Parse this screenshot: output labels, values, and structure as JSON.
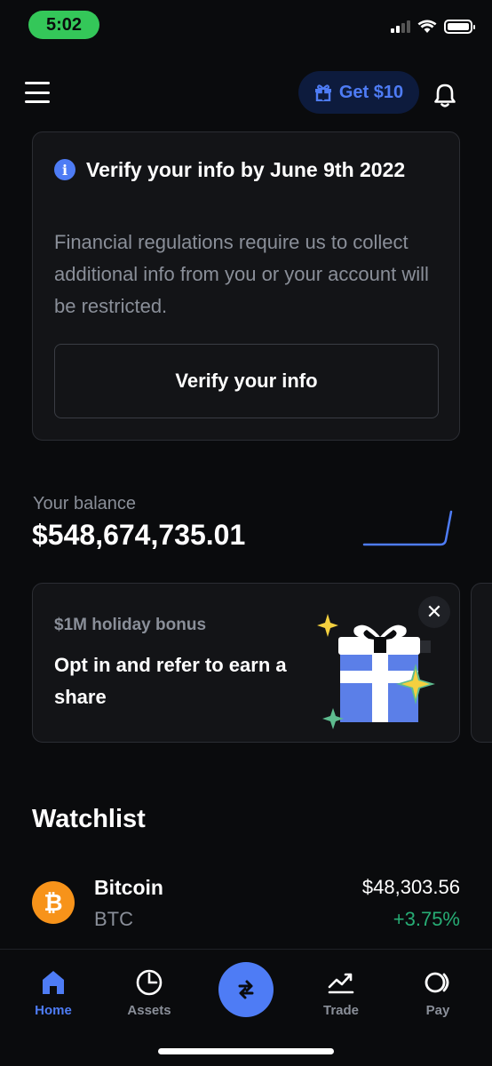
{
  "status_bar": {
    "time": "5:02"
  },
  "header": {
    "reward_label": "Get $10",
    "icons": [
      "menu-icon",
      "gift-icon",
      "bell-icon"
    ]
  },
  "verify_card": {
    "title": "Verify your info by June 9th 2022",
    "body": "Financial regulations require us to collect additional info from you or your account will be restricted.",
    "button_label": "Verify your info",
    "icon": "info-icon"
  },
  "balance": {
    "label": "Your balance",
    "value": "$548,674,735.01"
  },
  "promo": {
    "eyebrow": "$1M holiday bonus",
    "title": "Opt in and refer to earn a share",
    "close_symbol": "✕",
    "art": "gift-illustration"
  },
  "watchlist": {
    "title": "Watchlist",
    "items": [
      {
        "name": "Bitcoin",
        "symbol": "BTC",
        "price": "$48,303.56",
        "change": "+3.75%",
        "icon_glyph": "₿"
      }
    ]
  },
  "tab_bar": {
    "tabs": [
      {
        "label": "Home",
        "icon": "home-icon",
        "active": true
      },
      {
        "label": "Assets",
        "icon": "pie-chart-icon",
        "active": false
      },
      {
        "label": "",
        "icon": "swap-icon",
        "active": false
      },
      {
        "label": "Trade",
        "icon": "trend-icon",
        "active": false
      },
      {
        "label": "Pay",
        "icon": "pay-icon",
        "active": false
      }
    ]
  },
  "colors": {
    "accent": "#4e7cf5",
    "background": "#0a0b0d",
    "card": "#131417",
    "positive": "#27ad75",
    "bitcoin": "#f7931a",
    "time_pill": "#34c759"
  }
}
